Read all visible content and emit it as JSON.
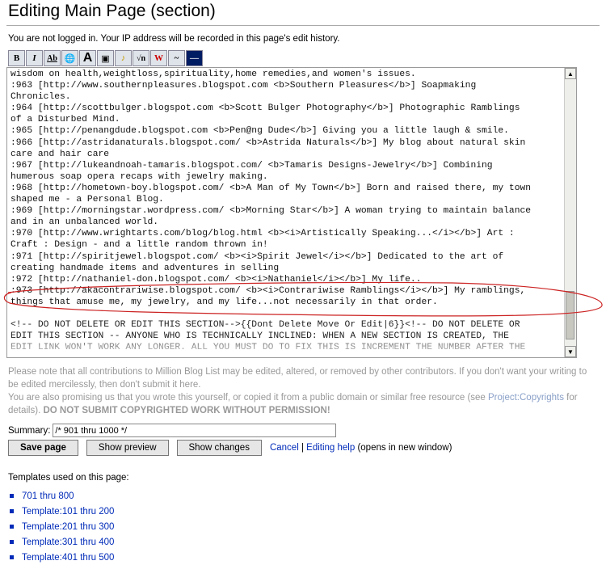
{
  "page": {
    "heading": "Editing Main Page (section)",
    "notice": "You are not logged in. Your IP address will be recorded in this page's edit history."
  },
  "toolbar": {
    "buttons": [
      {
        "label": "B",
        "icon": "bold-icon"
      },
      {
        "label": "I",
        "icon": "italic-icon"
      },
      {
        "label": "Ab",
        "icon": "internal-link-icon"
      },
      {
        "label": "🌐",
        "icon": "external-link-icon"
      },
      {
        "label": "A",
        "icon": "headline-icon"
      },
      {
        "label": "▣",
        "icon": "image-icon"
      },
      {
        "label": "♪",
        "icon": "media-icon"
      },
      {
        "label": "√n",
        "icon": "math-icon"
      },
      {
        "label": "W",
        "icon": "nowiki-icon"
      },
      {
        "label": "~",
        "icon": "signature-icon"
      },
      {
        "label": "—",
        "icon": "horizontal-line-icon"
      }
    ]
  },
  "editor": {
    "lines": [
      "wisdom on health,weightloss,spirituality,home remedies,and women's issues.",
      ":963 [http://www.southernpleasures.blogspot.com <b>Southern Pleasures</b>] Soapmaking",
      "Chronicles.",
      ":964 [http://scottbulger.blogspot.com <b>Scott Bulger Photography</b>] Photographic Ramblings",
      "of a Disturbed Mind.",
      ":965 [http://penangdude.blogspot.com <b>Pen@ng Dude</b>] Giving you a little laugh & smile.",
      ":966 [http://astridanaturals.blogspot.com/ <b>Astrida Naturals</b>] My blog about natural skin",
      "care and hair care",
      ":967 [http://lukeandnoah-tamaris.blogspot.com/ <b>Tamaris Designs-Jewelry</b>] Combining",
      "humerous soap opera recaps with jewelry making.",
      ":968 [http://hometown-boy.blogspot.com/ <b>A Man of My Town</b>] Born and raised there, my town",
      "shaped me - a Personal Blog.",
      ":969 [http://morningstar.wordpress.com/ <b>Morning Star</b>] A woman trying to maintain balance",
      "and in an unbalanced world.",
      ":970 [http://www.wrightarts.com/blog/blog.html <b><i>Artistically Speaking...</i></b>] Art :",
      "Craft : Design - and a little random thrown in!",
      ":971 [http://spiritjewel.blogspot.com/ <b><i>Spirit Jewel</i></b>] Dedicated to the art of",
      "creating handmade items and adventures in selling",
      ":972 [http://nathaniel-don.blogspot.com/ <b><i>Nathaniel</i></b>] My life..",
      ":973 [http://akacontrariwise.blogspot.com/ <b><i>Contrariwise Ramblings</i></b>] My ramblings,",
      "things that amuse me, my jewelry, and my life...not necessarily in that order.",
      "",
      "<!-- DO NOT DELETE OR EDIT THIS SECTION-->{{Dont Delete Move Or Edit|6}}<!-- DO NOT DELETE OR",
      "EDIT THIS SECTION -- ANYONE WHO IS TECHNICALLY INCLINED: WHEN A NEW SECTION IS CREATED, THE",
      "EDIT LINK WON'T WORK ANY LONGER. ALL YOU MUST DO TO FIX THIS IS INCREMENT THE NUMBER AFTER THE"
    ],
    "annotation_color": "#cc2222"
  },
  "warning": {
    "line1_pre": "Please note that all contributions to Million Blog List may be edited, altered, or removed by other contributors. If you don't want your writing to be edited mercilessly, then don't submit it here.",
    "line2_pre": "You are also promising us that you wrote this yourself, or copied it from a public domain or similar free resource (see ",
    "line2_link": "Project:Copyrights",
    "line2_post": " for details). ",
    "line2_bold": "DO NOT SUBMIT COPYRIGHTED WORK WITHOUT PERMISSION!"
  },
  "summary": {
    "label": "Summary:",
    "value": "/* 901 thru 1000 */"
  },
  "actions": {
    "save": "Save page",
    "preview": "Show preview",
    "changes": "Show changes",
    "cancel": "Cancel",
    "separator": " | ",
    "help": "Editing help",
    "help_suffix": " (opens in new window)"
  },
  "templates": {
    "heading": "Templates used on this page:",
    "items": [
      "701 thru 800",
      "Template:101 thru 200",
      "Template:201 thru 300",
      "Template:301 thru 400",
      "Template:401 thru 500"
    ]
  }
}
